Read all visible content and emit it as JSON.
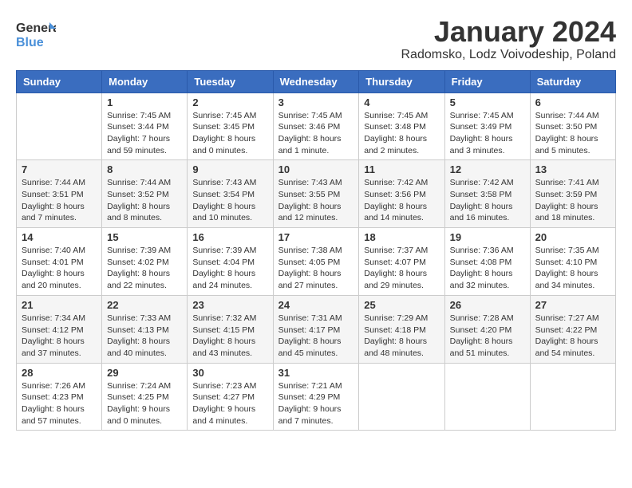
{
  "header": {
    "logo_line1": "General",
    "logo_line2": "Blue",
    "title": "January 2024",
    "subtitle": "Radomsko, Lodz Voivodeship, Poland"
  },
  "weekdays": [
    "Sunday",
    "Monday",
    "Tuesday",
    "Wednesday",
    "Thursday",
    "Friday",
    "Saturday"
  ],
  "weeks": [
    [
      {
        "day": "",
        "info": ""
      },
      {
        "day": "1",
        "info": "Sunrise: 7:45 AM\nSunset: 3:44 PM\nDaylight: 7 hours\nand 59 minutes."
      },
      {
        "day": "2",
        "info": "Sunrise: 7:45 AM\nSunset: 3:45 PM\nDaylight: 8 hours\nand 0 minutes."
      },
      {
        "day": "3",
        "info": "Sunrise: 7:45 AM\nSunset: 3:46 PM\nDaylight: 8 hours\nand 1 minute."
      },
      {
        "day": "4",
        "info": "Sunrise: 7:45 AM\nSunset: 3:48 PM\nDaylight: 8 hours\nand 2 minutes."
      },
      {
        "day": "5",
        "info": "Sunrise: 7:45 AM\nSunset: 3:49 PM\nDaylight: 8 hours\nand 3 minutes."
      },
      {
        "day": "6",
        "info": "Sunrise: 7:44 AM\nSunset: 3:50 PM\nDaylight: 8 hours\nand 5 minutes."
      }
    ],
    [
      {
        "day": "7",
        "info": "Sunrise: 7:44 AM\nSunset: 3:51 PM\nDaylight: 8 hours\nand 7 minutes."
      },
      {
        "day": "8",
        "info": "Sunrise: 7:44 AM\nSunset: 3:52 PM\nDaylight: 8 hours\nand 8 minutes."
      },
      {
        "day": "9",
        "info": "Sunrise: 7:43 AM\nSunset: 3:54 PM\nDaylight: 8 hours\nand 10 minutes."
      },
      {
        "day": "10",
        "info": "Sunrise: 7:43 AM\nSunset: 3:55 PM\nDaylight: 8 hours\nand 12 minutes."
      },
      {
        "day": "11",
        "info": "Sunrise: 7:42 AM\nSunset: 3:56 PM\nDaylight: 8 hours\nand 14 minutes."
      },
      {
        "day": "12",
        "info": "Sunrise: 7:42 AM\nSunset: 3:58 PM\nDaylight: 8 hours\nand 16 minutes."
      },
      {
        "day": "13",
        "info": "Sunrise: 7:41 AM\nSunset: 3:59 PM\nDaylight: 8 hours\nand 18 minutes."
      }
    ],
    [
      {
        "day": "14",
        "info": "Sunrise: 7:40 AM\nSunset: 4:01 PM\nDaylight: 8 hours\nand 20 minutes."
      },
      {
        "day": "15",
        "info": "Sunrise: 7:39 AM\nSunset: 4:02 PM\nDaylight: 8 hours\nand 22 minutes."
      },
      {
        "day": "16",
        "info": "Sunrise: 7:39 AM\nSunset: 4:04 PM\nDaylight: 8 hours\nand 24 minutes."
      },
      {
        "day": "17",
        "info": "Sunrise: 7:38 AM\nSunset: 4:05 PM\nDaylight: 8 hours\nand 27 minutes."
      },
      {
        "day": "18",
        "info": "Sunrise: 7:37 AM\nSunset: 4:07 PM\nDaylight: 8 hours\nand 29 minutes."
      },
      {
        "day": "19",
        "info": "Sunrise: 7:36 AM\nSunset: 4:08 PM\nDaylight: 8 hours\nand 32 minutes."
      },
      {
        "day": "20",
        "info": "Sunrise: 7:35 AM\nSunset: 4:10 PM\nDaylight: 8 hours\nand 34 minutes."
      }
    ],
    [
      {
        "day": "21",
        "info": "Sunrise: 7:34 AM\nSunset: 4:12 PM\nDaylight: 8 hours\nand 37 minutes."
      },
      {
        "day": "22",
        "info": "Sunrise: 7:33 AM\nSunset: 4:13 PM\nDaylight: 8 hours\nand 40 minutes."
      },
      {
        "day": "23",
        "info": "Sunrise: 7:32 AM\nSunset: 4:15 PM\nDaylight: 8 hours\nand 43 minutes."
      },
      {
        "day": "24",
        "info": "Sunrise: 7:31 AM\nSunset: 4:17 PM\nDaylight: 8 hours\nand 45 minutes."
      },
      {
        "day": "25",
        "info": "Sunrise: 7:29 AM\nSunset: 4:18 PM\nDaylight: 8 hours\nand 48 minutes."
      },
      {
        "day": "26",
        "info": "Sunrise: 7:28 AM\nSunset: 4:20 PM\nDaylight: 8 hours\nand 51 minutes."
      },
      {
        "day": "27",
        "info": "Sunrise: 7:27 AM\nSunset: 4:22 PM\nDaylight: 8 hours\nand 54 minutes."
      }
    ],
    [
      {
        "day": "28",
        "info": "Sunrise: 7:26 AM\nSunset: 4:23 PM\nDaylight: 8 hours\nand 57 minutes."
      },
      {
        "day": "29",
        "info": "Sunrise: 7:24 AM\nSunset: 4:25 PM\nDaylight: 9 hours\nand 0 minutes."
      },
      {
        "day": "30",
        "info": "Sunrise: 7:23 AM\nSunset: 4:27 PM\nDaylight: 9 hours\nand 4 minutes."
      },
      {
        "day": "31",
        "info": "Sunrise: 7:21 AM\nSunset: 4:29 PM\nDaylight: 9 hours\nand 7 minutes."
      },
      {
        "day": "",
        "info": ""
      },
      {
        "day": "",
        "info": ""
      },
      {
        "day": "",
        "info": ""
      }
    ]
  ]
}
